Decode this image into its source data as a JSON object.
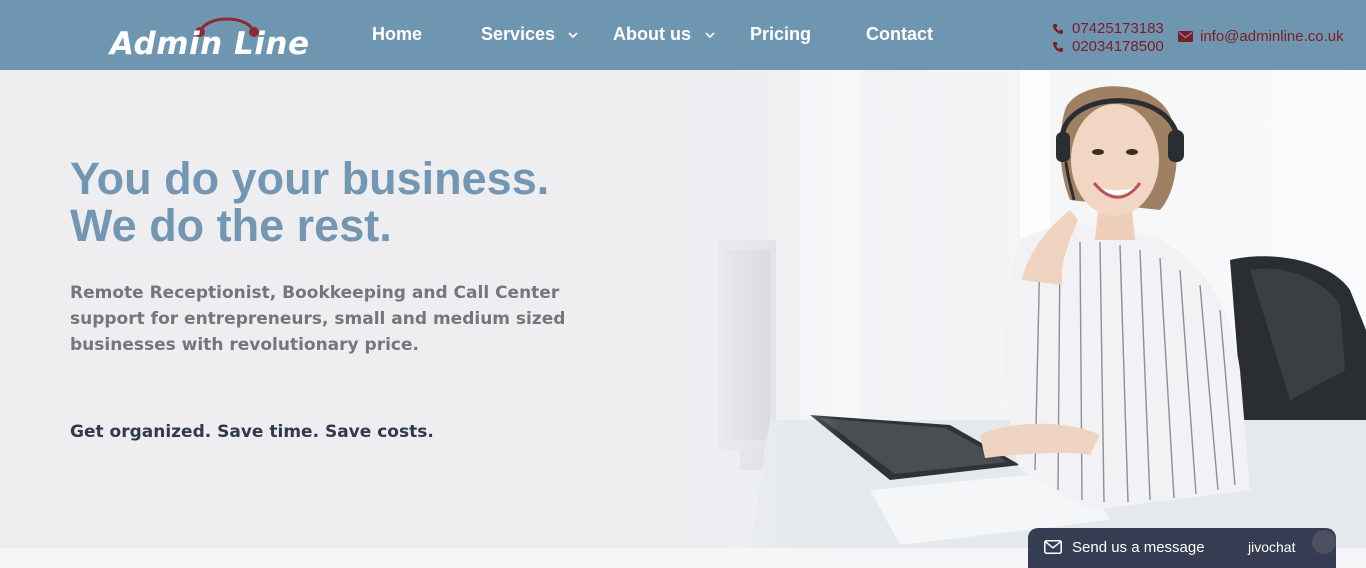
{
  "header": {
    "logo_text": "Admin Line",
    "nav": {
      "home": "Home",
      "services": "Services",
      "about": "About us",
      "pricing": "Pricing",
      "contact": "Contact"
    },
    "phones": [
      "07425173183",
      "02034178500"
    ],
    "email": "info@adminline.co.uk",
    "icons": {
      "phone": "phone-icon",
      "email": "envelope-icon",
      "dropdown": "chevron-down-icon"
    }
  },
  "hero": {
    "headline_line1": "You do your business.",
    "headline_line2": "We do the rest.",
    "subtext": "Remote Receptionist, Bookkeeping and Call Center support for entrepreneurs, small and medium sized businesses with revolutionary price.",
    "tagline": "Get organized. Save time. Save costs."
  },
  "chat": {
    "label": "Send us a message",
    "brand": "jivochat"
  },
  "colors": {
    "header_bg": "#6f96b1",
    "accent_red": "#7d1c24",
    "headline": "#7397b3",
    "chat_bg": "#363c51"
  }
}
